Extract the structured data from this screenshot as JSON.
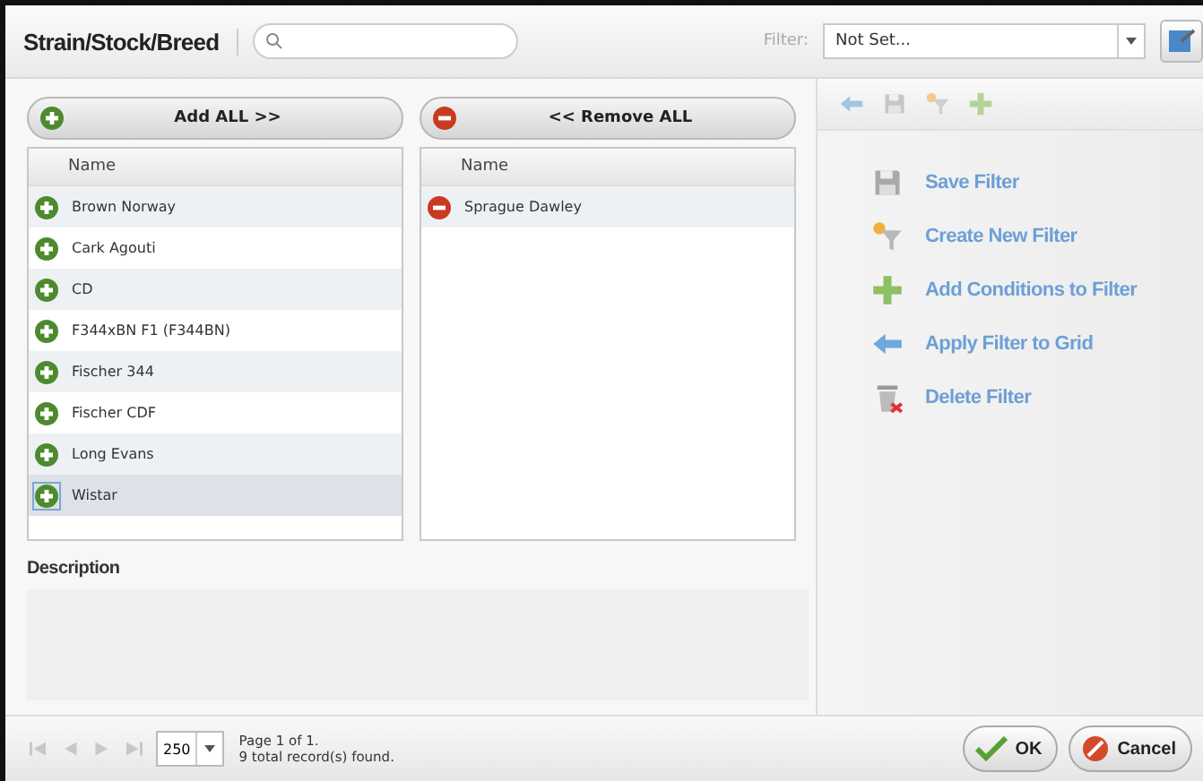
{
  "title": "Strain/Stock/Breed",
  "filter": {
    "label": "Filter:",
    "value": "Not Set..."
  },
  "add_all": "Add ALL >>",
  "remove_all": "<< Remove ALL",
  "available": {
    "column": "Name",
    "rows": [
      {
        "name": "Brown Norway",
        "selected": false
      },
      {
        "name": "Cark Agouti",
        "selected": false
      },
      {
        "name": "CD",
        "selected": false
      },
      {
        "name": "F344xBN F1 (F344BN)",
        "selected": false
      },
      {
        "name": "Fischer 344",
        "selected": false
      },
      {
        "name": "Fischer CDF",
        "selected": false
      },
      {
        "name": "Long Evans",
        "selected": false
      },
      {
        "name": "Wistar",
        "selected": true
      }
    ]
  },
  "chosen": {
    "column": "Name",
    "rows": [
      {
        "name": "Sprague Dawley",
        "selected": false
      }
    ]
  },
  "description": {
    "label": "Description"
  },
  "actions": [
    {
      "kind": "save",
      "label": "Save Filter"
    },
    {
      "kind": "create",
      "label": "Create New Filter"
    },
    {
      "kind": "add",
      "label": "Add Conditions to Filter"
    },
    {
      "kind": "apply",
      "label": "Apply Filter to Grid"
    },
    {
      "kind": "delete",
      "label": "Delete Filter"
    }
  ],
  "pager": {
    "page_size": "250",
    "page_info": "Page 1 of 1.",
    "records": "9 total record(s) found."
  },
  "buttons": [
    {
      "kind": "ok",
      "label": "OK"
    },
    {
      "kind": "cancel",
      "label": "Cancel"
    }
  ]
}
